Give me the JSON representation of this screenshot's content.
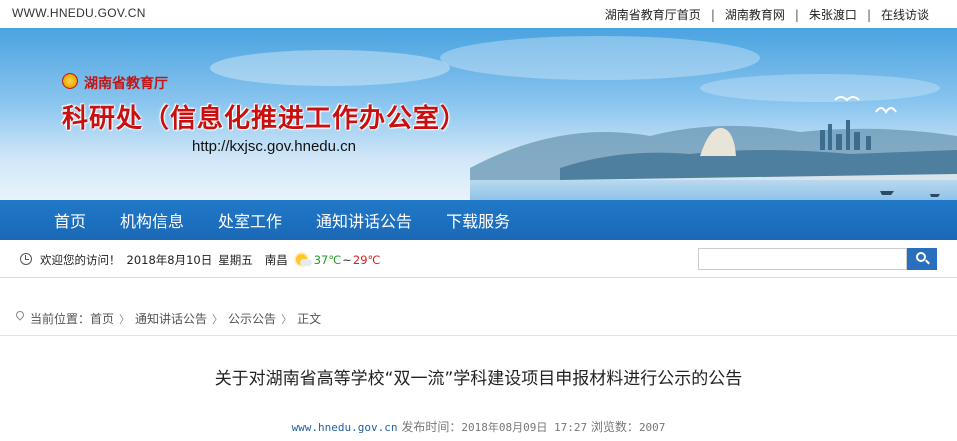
{
  "topbar": {
    "site_url": "WWW.HNEDU.GOV.CN",
    "links": [
      {
        "label": "湖南省教育厅首页"
      },
      {
        "label": "湖南教育网"
      },
      {
        "label": "朱张渡口"
      },
      {
        "label": "在线访谈"
      }
    ],
    "separator": "|"
  },
  "banner": {
    "department": "湖南省教育厅",
    "office_title": "科研处（信息化推进工作办公室）",
    "office_url": "http://kxjsc.gov.hnedu.cn",
    "emblem_icon": "national-emblem-icon",
    "colors": {
      "title": "#c81010",
      "sky": "#4aa3e0"
    }
  },
  "nav": {
    "items": [
      {
        "label": "首页"
      },
      {
        "label": "机构信息"
      },
      {
        "label": "处室工作"
      },
      {
        "label": "通知讲话公告"
      },
      {
        "label": "下载服务"
      }
    ],
    "color": "#1c6fbd"
  },
  "infobar": {
    "welcome": "欢迎您的访问！",
    "date": "2018年8月10日",
    "weekday": "星期五",
    "city": "南昌",
    "weather_icon": "sunny-cloudy-icon",
    "temp_low": "37℃",
    "tilde": "~",
    "temp_high": "29℃",
    "search_value": "",
    "search_icon": "search-icon"
  },
  "breadcrumb": {
    "prefix": "当前位置：",
    "items": [
      {
        "label": "首页"
      },
      {
        "label": "通知讲话公告"
      },
      {
        "label": "公示公告"
      },
      {
        "label": "正文"
      }
    ],
    "chevron": "〉"
  },
  "article": {
    "title": "关于对湖南省高等学校“双一流”学科建设项目申报材料进行公示的公告",
    "source": "www.hnedu.gov.cn",
    "published_label": "发布时间：",
    "published": "2018年08月09日 17:27",
    "views_label": "浏览数：",
    "views": "2007"
  }
}
